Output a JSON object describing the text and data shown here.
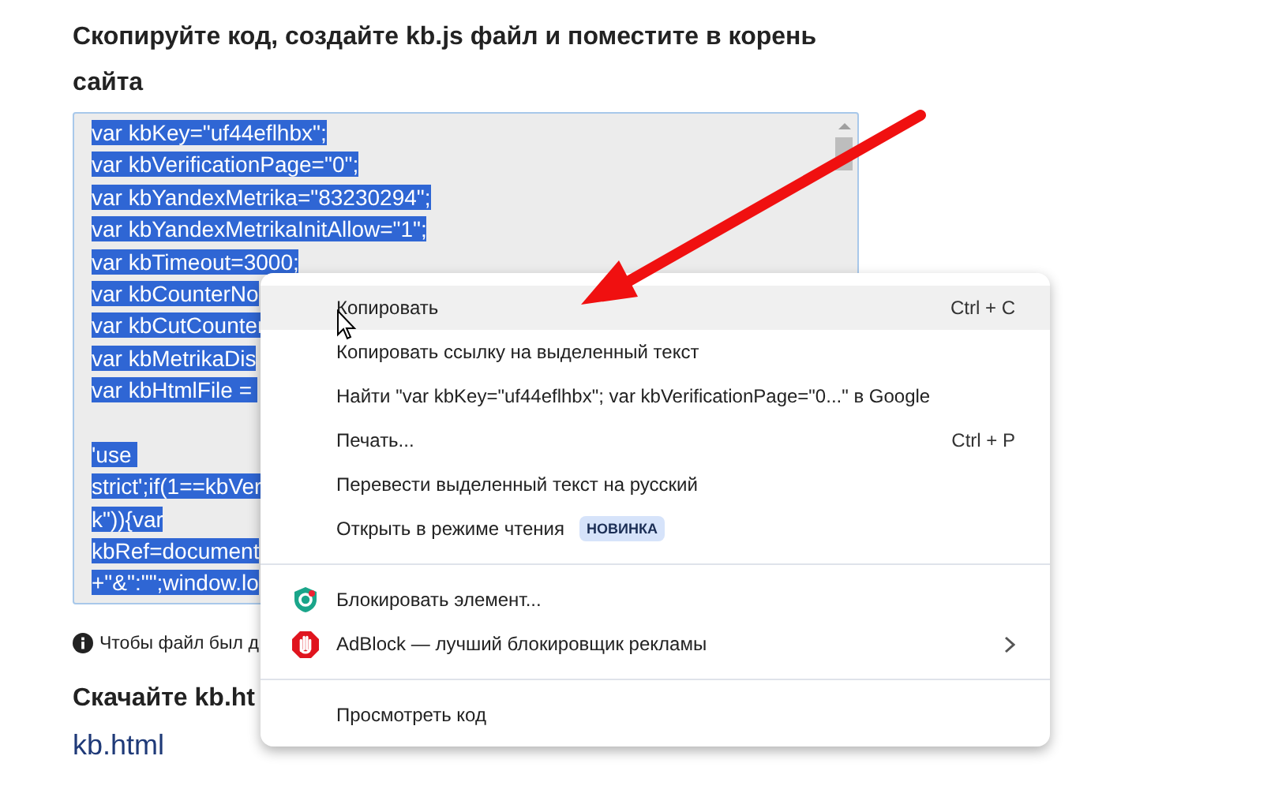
{
  "heading": "Скопируйте код, создайте kb.js файл и поместите в корень сайта",
  "code_selected": true,
  "code_blocks": [
    [
      "var kbKey=\"uf44eflhbx\";",
      "var kbVerificationPage=\"0\";",
      "var kbYandexMetrika=\"83230294\";",
      "var kbYandexMetrikaInitAllow=\"1\";",
      "var kbTimeout=3000;",
      "var kbCounterNo",
      "var kbCutCounter",
      "var kbMetrikaDis",
      "var kbHtmlFile = "
    ],
    [
      "'use ",
      "strict';if(1==kbVer",
      "k\")){var",
      "kbRef=document",
      "+\"&\":\"\";window.lo"
    ]
  ],
  "info_note": "Чтобы файл был д",
  "download_heading": "Скачайте kb.ht",
  "download_link": "kb.html",
  "context_menu": {
    "groups": [
      {
        "items": [
          {
            "kind": "text",
            "label": "Копировать",
            "shortcut": "Ctrl + C",
            "highlighted": true
          },
          {
            "kind": "text",
            "label": "Копировать ссылку на выделенный текст",
            "highlighted": false
          },
          {
            "kind": "text",
            "label": "Найти \"var kbKey=\"uf44eflhbx\"; var kbVerificationPage=\"0...\" в Google",
            "highlighted": false
          },
          {
            "kind": "text",
            "label": "Печать...",
            "shortcut": "Ctrl + P",
            "highlighted": false
          },
          {
            "kind": "text",
            "label": "Перевести выделенный текст на русский",
            "highlighted": false
          },
          {
            "kind": "text",
            "label": "Открыть в режиме чтения",
            "badge": "НОВИНКА",
            "highlighted": false
          }
        ]
      },
      {
        "items": [
          {
            "kind": "shield",
            "label": "Блокировать элемент...",
            "highlighted": false
          },
          {
            "kind": "hand",
            "label": "AdBlock — лучший блокировщик рекламы",
            "submenu": true,
            "highlighted": false
          }
        ]
      },
      {
        "items": [
          {
            "kind": "text",
            "label": "Просмотреть код",
            "highlighted": false
          }
        ]
      }
    ]
  }
}
